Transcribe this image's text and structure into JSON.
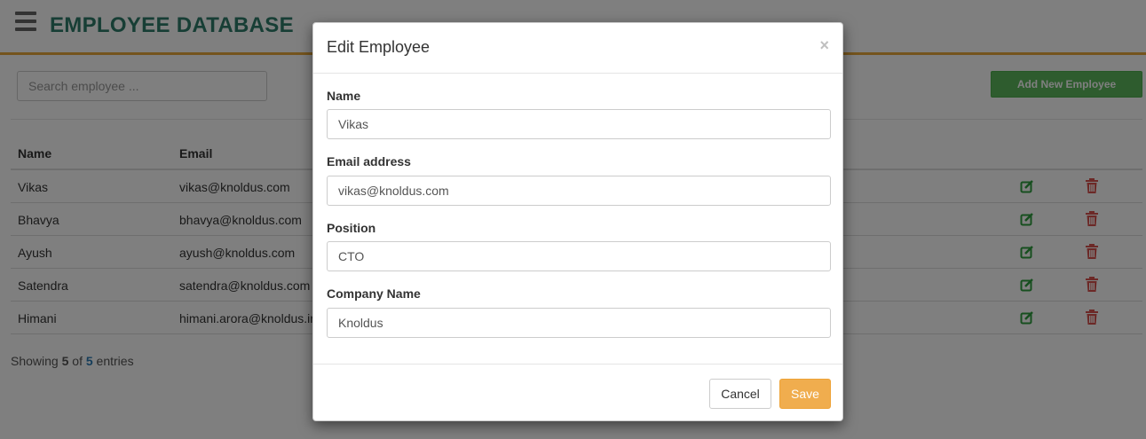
{
  "header": {
    "title": "EMPLOYEE DATABASE",
    "menu_icon": "hamburger-menu-icon"
  },
  "toolbar": {
    "search_placeholder": "Search employee ...",
    "add_label": "Add New Employee"
  },
  "table": {
    "columns": [
      "Name",
      "Email"
    ],
    "rows": [
      {
        "name": "Vikas",
        "email": "vikas@knoldus.com"
      },
      {
        "name": "Bhavya",
        "email": "bhavya@knoldus.com"
      },
      {
        "name": "Ayush",
        "email": "ayush@knoldus.com"
      },
      {
        "name": "Satendra",
        "email": "satendra@knoldus.com"
      },
      {
        "name": "Himani",
        "email": "himani.arora@knoldus.in"
      }
    ],
    "row_icons": [
      "edit-icon",
      "trash-icon"
    ]
  },
  "footer": {
    "prefix": "Showing ",
    "shown": "5",
    "of": " of ",
    "total": "5",
    "suffix": " entries"
  },
  "modal": {
    "title": "Edit Employee",
    "close_symbol": "×",
    "fields": [
      {
        "label": "Name",
        "value": "Vikas"
      },
      {
        "label": "Email address",
        "value": "vikas@knoldus.com"
      },
      {
        "label": "Position",
        "value": "CTO"
      },
      {
        "label": "Company Name",
        "value": "Knoldus"
      }
    ],
    "cancel_label": "Cancel",
    "save_label": "Save"
  },
  "colors": {
    "title": "#2e7d6a",
    "header_accent": "#e8a93b",
    "add_button": "#5cb85c",
    "edit_icon": "#2e9e3e",
    "delete_icon": "#d9534f",
    "save_button": "#f0ad4e"
  }
}
